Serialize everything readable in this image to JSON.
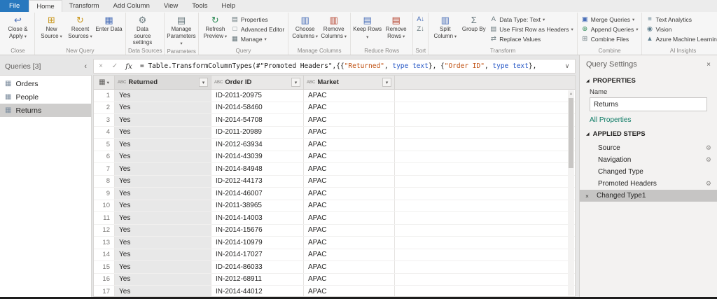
{
  "colors": {
    "file_tab_bg": "#2878be",
    "link": "#0b7a64",
    "formula_string": "#bf4e0e",
    "formula_keyword": "#2456c5",
    "selected_row_bg": "#cfcecd"
  },
  "tabbar": {
    "file": "File",
    "tabs": [
      "Home",
      "Transform",
      "Add Column",
      "View",
      "Tools",
      "Help"
    ],
    "active": "Home"
  },
  "ribbon": {
    "groups": [
      {
        "label": "Close",
        "items": [
          {
            "t": "large",
            "name": "close-and-apply-button",
            "label": "Close & Apply",
            "dropdown": true,
            "icon": "↩",
            "ic": "#4a6fb8"
          }
        ]
      },
      {
        "label": "New Query",
        "items": [
          {
            "t": "large",
            "name": "new-source-button",
            "label": "New Source",
            "dropdown": true,
            "icon": "⊞",
            "ic": "#c9971c"
          },
          {
            "t": "large",
            "name": "recent-sources-button",
            "label": "Recent Sources",
            "dropdown": true,
            "icon": "↻",
            "ic": "#c9971c"
          },
          {
            "t": "large",
            "name": "enter-data-button",
            "label": "Enter Data",
            "dropdown": false,
            "icon": "▦",
            "ic": "#4a6fb8"
          }
        ]
      },
      {
        "label": "Data Sources",
        "items": [
          {
            "t": "large",
            "name": "data-source-settings-button",
            "label": "Data source settings",
            "dropdown": false,
            "icon": "⚙",
            "ic": "#69797e"
          }
        ]
      },
      {
        "label": "Parameters",
        "items": [
          {
            "t": "large",
            "name": "manage-parameters-button",
            "label": "Manage Parameters",
            "dropdown": true,
            "icon": "▤",
            "ic": "#69797e"
          }
        ]
      },
      {
        "label": "Query",
        "items": [
          {
            "t": "large",
            "name": "refresh-preview-button",
            "label": "Refresh Preview",
            "dropdown": true,
            "icon": "↻",
            "ic": "#2e8b57"
          },
          {
            "t": "stack",
            "buttons": [
              {
                "name": "properties-button",
                "label": "Properties",
                "icon": "▤",
                "ic": "#69797e"
              },
              {
                "name": "advanced-editor-button",
                "label": "Advanced Editor",
                "icon": "□",
                "ic": "#69797e"
              },
              {
                "name": "manage-button",
                "label": "Manage",
                "dropdown": true,
                "icon": "▦",
                "ic": "#69797e"
              }
            ]
          }
        ]
      },
      {
        "label": "Manage Columns",
        "items": [
          {
            "t": "large",
            "name": "choose-columns-button",
            "label": "Choose Columns",
            "dropdown": true,
            "icon": "▥",
            "ic": "#4a6fb8"
          },
          {
            "t": "large",
            "name": "remove-columns-button",
            "label": "Remove Columns",
            "dropdown": true,
            "icon": "▥",
            "ic": "#b5432e"
          }
        ]
      },
      {
        "label": "Reduce Rows",
        "items": [
          {
            "t": "large",
            "name": "keep-rows-button",
            "label": "Keep Rows",
            "dropdown": true,
            "icon": "▤",
            "ic": "#4a6fb8"
          },
          {
            "t": "large",
            "name": "remove-rows-button",
            "label": "Remove Rows",
            "dropdown": true,
            "icon": "▤",
            "ic": "#b5432e"
          }
        ]
      },
      {
        "label": "Sort",
        "items": [
          {
            "t": "stack",
            "buttons": [
              {
                "name": "sort-ascending-button",
                "label": "",
                "icon": "A↓",
                "ic": "#4a6fb8"
              },
              {
                "name": "sort-descending-button",
                "label": "",
                "icon": "Z↓",
                "ic": "#69797e"
              }
            ]
          }
        ]
      },
      {
        "label": "Transform",
        "items": [
          {
            "t": "large",
            "name": "split-column-button",
            "label": "Split Column",
            "dropdown": true,
            "icon": "▥",
            "ic": "#4a6fb8"
          },
          {
            "t": "large",
            "name": "group-by-button",
            "label": "Group By",
            "dropdown": false,
            "icon": "Σ",
            "ic": "#69797e"
          },
          {
            "t": "stack",
            "buttons": [
              {
                "name": "data-type-button",
                "label": "Data Type: Text",
                "dropdown": true,
                "icon": "A",
                "ic": "#69797e"
              },
              {
                "name": "use-first-row-as-headers-button",
                "label": "Use First Row as Headers",
                "dropdown": true,
                "icon": "▤",
                "ic": "#69797e"
              },
              {
                "name": "replace-values-button",
                "label": "Replace Values",
                "icon": "⇄",
                "ic": "#69797e"
              }
            ]
          }
        ]
      },
      {
        "label": "Combine",
        "items": [
          {
            "t": "stack",
            "buttons": [
              {
                "name": "merge-queries-button",
                "label": "Merge Queries",
                "dropdown": true,
                "icon": "▣",
                "ic": "#4a6fb8"
              },
              {
                "name": "append-queries-button",
                "label": "Append Queries",
                "dropdown": true,
                "icon": "⊕",
                "ic": "#2e8b57"
              },
              {
                "name": "combine-files-button",
                "label": "Combine Files",
                "icon": "⊞",
                "ic": "#69797e"
              }
            ]
          }
        ]
      },
      {
        "label": "AI Insights",
        "items": [
          {
            "t": "stack",
            "buttons": [
              {
                "name": "text-analytics-button",
                "label": "Text Analytics",
                "icon": "≡",
                "ic": "#5f7f8f"
              },
              {
                "name": "vision-button",
                "label": "Vision",
                "icon": "◉",
                "ic": "#5f7f8f"
              },
              {
                "name": "azure-machine-learning-button",
                "label": "Azure Machine Learning",
                "icon": "▲",
                "ic": "#5f7f8f"
              }
            ]
          }
        ]
      }
    ]
  },
  "formula_bar": {
    "segments": [
      {
        "cls": "plain",
        "text": "= Table.TransformColumnTypes(#\"Promoted Headers\",{{"
      },
      {
        "cls": "string",
        "text": "\"Returned\""
      },
      {
        "cls": "plain",
        "text": ", "
      },
      {
        "cls": "keyword",
        "text": "type text"
      },
      {
        "cls": "plain",
        "text": "}, {"
      },
      {
        "cls": "string",
        "text": "\"Order ID\""
      },
      {
        "cls": "plain",
        "text": ", "
      },
      {
        "cls": "keyword",
        "text": "type text"
      },
      {
        "cls": "plain",
        "text": "},"
      }
    ]
  },
  "queries": {
    "header": "Queries [3]",
    "items": [
      {
        "label": "Orders",
        "selected": false
      },
      {
        "label": "People",
        "selected": false
      },
      {
        "label": "Returns",
        "selected": true
      }
    ]
  },
  "table": {
    "columns": [
      {
        "name": "Returned",
        "type_icon": "ABC",
        "selected": true
      },
      {
        "name": "Order ID",
        "type_icon": "ABC",
        "selected": false
      },
      {
        "name": "Market",
        "type_icon": "ABC",
        "selected": false
      }
    ],
    "rows": [
      {
        "n": 1,
        "cells": [
          "Yes",
          "ID-2011-20975",
          "APAC"
        ]
      },
      {
        "n": 2,
        "cells": [
          "Yes",
          "IN-2014-58460",
          "APAC"
        ]
      },
      {
        "n": 3,
        "cells": [
          "Yes",
          "IN-2014-54708",
          "APAC"
        ]
      },
      {
        "n": 4,
        "cells": [
          "Yes",
          "ID-2011-20989",
          "APAC"
        ]
      },
      {
        "n": 5,
        "cells": [
          "Yes",
          "IN-2012-63934",
          "APAC"
        ]
      },
      {
        "n": 6,
        "cells": [
          "Yes",
          "IN-2014-43039",
          "APAC"
        ]
      },
      {
        "n": 7,
        "cells": [
          "Yes",
          "IN-2014-84948",
          "APAC"
        ]
      },
      {
        "n": 8,
        "cells": [
          "Yes",
          "ID-2012-44173",
          "APAC"
        ]
      },
      {
        "n": 9,
        "cells": [
          "Yes",
          "IN-2014-46007",
          "APAC"
        ]
      },
      {
        "n": 10,
        "cells": [
          "Yes",
          "IN-2011-38965",
          "APAC"
        ]
      },
      {
        "n": 11,
        "cells": [
          "Yes",
          "IN-2014-14003",
          "APAC"
        ]
      },
      {
        "n": 12,
        "cells": [
          "Yes",
          "IN-2014-15676",
          "APAC"
        ]
      },
      {
        "n": 13,
        "cells": [
          "Yes",
          "IN-2014-10979",
          "APAC"
        ]
      },
      {
        "n": 14,
        "cells": [
          "Yes",
          "IN-2014-17027",
          "APAC"
        ]
      },
      {
        "n": 15,
        "cells": [
          "Yes",
          "ID-2014-86033",
          "APAC"
        ]
      },
      {
        "n": 16,
        "cells": [
          "Yes",
          "IN-2012-68911",
          "APAC"
        ]
      },
      {
        "n": 17,
        "cells": [
          "Yes",
          "IN-2014-44012",
          "APAC"
        ]
      }
    ]
  },
  "settings": {
    "title": "Query Settings",
    "properties_label": "PROPERTIES",
    "name_label": "Name",
    "name_value": "Returns",
    "all_properties": "All Properties",
    "applied_steps_label": "APPLIED STEPS",
    "steps": [
      {
        "label": "Source",
        "gear": true,
        "selected": false
      },
      {
        "label": "Navigation",
        "gear": true,
        "selected": false
      },
      {
        "label": "Changed Type",
        "gear": false,
        "selected": false
      },
      {
        "label": "Promoted Headers",
        "gear": true,
        "selected": false
      },
      {
        "label": "Changed Type1",
        "gear": false,
        "selected": true
      }
    ]
  }
}
